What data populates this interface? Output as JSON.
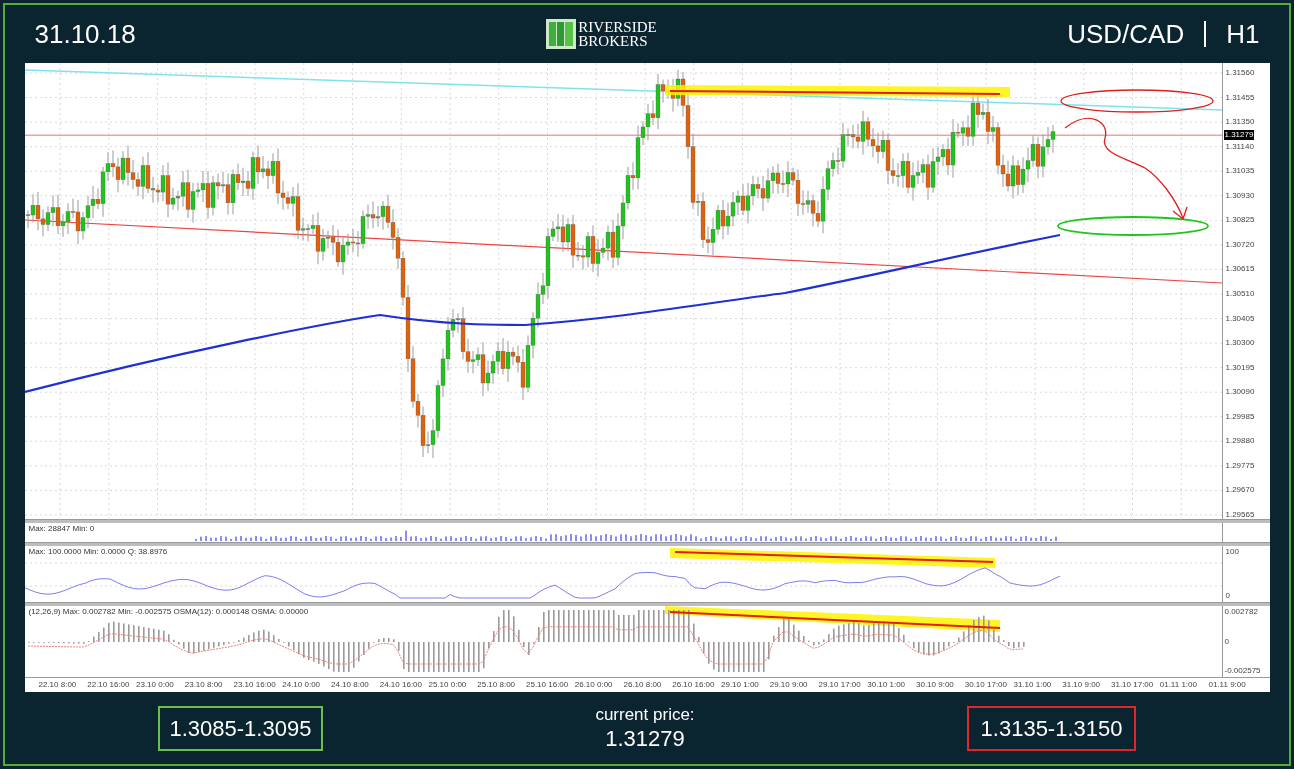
{
  "header": {
    "date": "31.10.18",
    "logo": {
      "line1": "RIVERSIDE",
      "line2": "BROKERS"
    },
    "symbol": "USD/CAD",
    "timeframe": "H1"
  },
  "chart": {
    "price_axis": [
      {
        "label": "1.31560",
        "kind": "tick"
      },
      {
        "label": "1.31455",
        "kind": "tick"
      },
      {
        "label": "1.31350",
        "kind": "tick"
      },
      {
        "label": "1.31279",
        "kind": "current"
      },
      {
        "label": "1.31140",
        "kind": "tick"
      },
      {
        "label": "1.31035",
        "kind": "tick"
      },
      {
        "label": "1.30930",
        "kind": "tick"
      },
      {
        "label": "1.30825",
        "kind": "tick"
      },
      {
        "label": "1.30720",
        "kind": "tick"
      },
      {
        "label": "1.30615",
        "kind": "tick"
      },
      {
        "label": "1.30510",
        "kind": "tick"
      },
      {
        "label": "1.30405",
        "kind": "tick"
      },
      {
        "label": "1.30300",
        "kind": "tick"
      },
      {
        "label": "1.30195",
        "kind": "tick"
      },
      {
        "label": "1.30090",
        "kind": "tick"
      },
      {
        "label": "1.29985",
        "kind": "tick"
      },
      {
        "label": "1.29880",
        "kind": "tick"
      },
      {
        "label": "1.29775",
        "kind": "tick"
      },
      {
        "label": "1.29670",
        "kind": "tick"
      },
      {
        "label": "1.29565",
        "kind": "tick"
      }
    ],
    "volume_pane": {
      "header": "Max: 28847 Min: 0"
    },
    "rsi_pane": {
      "header": "Max: 100.0000 Min: 0.0000 Q: 38.8976",
      "axis": [
        "100",
        "0"
      ]
    },
    "macd_pane": {
      "header": "(12,26,9) Max: 0.002782 Min: -0.002575 OSMA(12): 0.000148 OSMA: 0.00000",
      "axis": [
        "0.002782",
        "0",
        "-0.002575"
      ]
    },
    "time_axis": [
      "22.10 8:00",
      "22.10 16:00",
      "23.10 0:00",
      "23.10 8:00",
      "23.10 16:00",
      "24.10 0:00",
      "24.10 8:00",
      "24.10 16:00",
      "25.10 0:00",
      "25.10 8:00",
      "25.10 16:00",
      "26.10 0:00",
      "26.10 8:00",
      "26.10 16:00",
      "29.10 1:00",
      "29.10 9:00",
      "29.10 17:00",
      "30.10 1:00",
      "30.10 9:00",
      "30.10 17:00",
      "31.10 1:00",
      "31.10 9:00",
      "31.10 17:00",
      "01.11 1:00",
      "01.11 9:00"
    ]
  },
  "footer": {
    "support": "1.3085-1.3095",
    "current_price_caption": "current price:",
    "current_price": "1.31279",
    "resistance": "1.3135-1.3150"
  }
}
